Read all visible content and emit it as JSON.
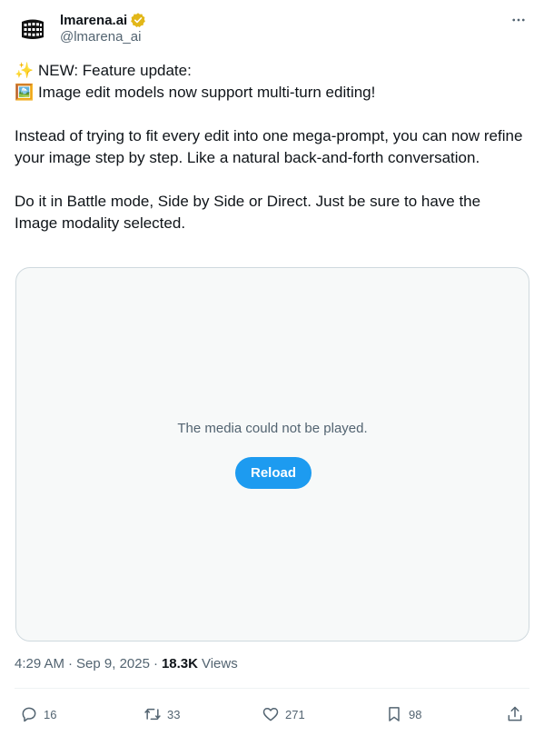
{
  "author": {
    "display_name": "lmarena.ai",
    "handle": "@lmarena_ai",
    "verified_color": "#e2b719"
  },
  "post": {
    "lines": [
      {
        "emoji": "✨",
        "text": "NEW: Feature update:"
      },
      {
        "emoji": "🖼️",
        "text": "Image edit models now support multi-turn editing!"
      }
    ],
    "paragraph_1": "Instead of trying to fit every edit into one mega-prompt, you can now refine your image step by step. Like a natural back-and-forth conversation.",
    "paragraph_2": "Do it in Battle mode, Side by Side or Direct. Just be sure to have the Image modality selected."
  },
  "media": {
    "message": "The media could not be played.",
    "reload_label": "Reload"
  },
  "meta": {
    "time": "4:29 AM",
    "date": "Sep 9, 2025",
    "views_count": "18.3K",
    "views_label": "Views"
  },
  "actions": {
    "replies": "16",
    "reposts": "33",
    "likes": "271",
    "bookmarks": "98"
  },
  "colors": {
    "accent": "#1d9bf0",
    "text": "#0f1419",
    "secondary": "#536471"
  }
}
